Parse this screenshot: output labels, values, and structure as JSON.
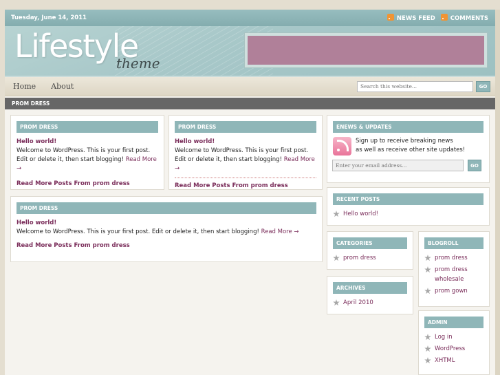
{
  "topbar": {
    "date": "Tuesday, June 14, 2011",
    "news_feed": "NEWS FEED",
    "comments": "COMMENTS"
  },
  "header": {
    "logo_main": "Lifestyle",
    "logo_sub": "theme"
  },
  "nav": {
    "items": [
      "Home",
      "About"
    ],
    "search_placeholder": "Search this website...",
    "search_button": "GO"
  },
  "breadcrumb": "PROM DRESS",
  "posts": [
    {
      "section": "PROM DRESS",
      "title": "Hello world!",
      "text": "Welcome to WordPress. This is your first post. Edit or delete it, then start blogging!",
      "more": "Read More →",
      "readmore": "Read More Posts From prom dress"
    },
    {
      "section": "PROM DRESS",
      "title": "Hello world!",
      "text": "Welcome to WordPress. This is your first post. Edit or delete it, then start blogging!",
      "more": "Read More →",
      "readmore": "Read More Posts From prom dress"
    },
    {
      "section": "PROM DRESS",
      "title": "Hello world!",
      "text": "Welcome to WordPress. This is your first post. Edit or delete it, then start blogging!",
      "more": "Read More →",
      "readmore": "Read More Posts From prom dress"
    }
  ],
  "sidebar": {
    "enews": {
      "title": "ENEWS & UPDATES",
      "line1": "Sign up to receive breaking news",
      "line2": "as well as receive other site updates!",
      "placeholder": "Enter your email address...",
      "button": "GO"
    },
    "recent": {
      "title": "RECENT POSTS",
      "items": [
        "Hello world!"
      ]
    },
    "categories": {
      "title": "CATEGORIES",
      "items": [
        "prom dress"
      ]
    },
    "archives": {
      "title": "ARCHIVES",
      "items": [
        "April 2010"
      ]
    },
    "blogroll": {
      "title": "BLOGROLL",
      "items": [
        "prom dress",
        "prom dress wholesale",
        "prom gown"
      ]
    },
    "admin": {
      "title": "ADMIN",
      "items": [
        "Log in",
        "WordPress",
        "XHTML"
      ]
    }
  },
  "colors": {
    "accent": "#8fb6b8",
    "link": "#7a2d5a",
    "banner": "#b08099",
    "breadcrumb_bg": "#666666"
  }
}
